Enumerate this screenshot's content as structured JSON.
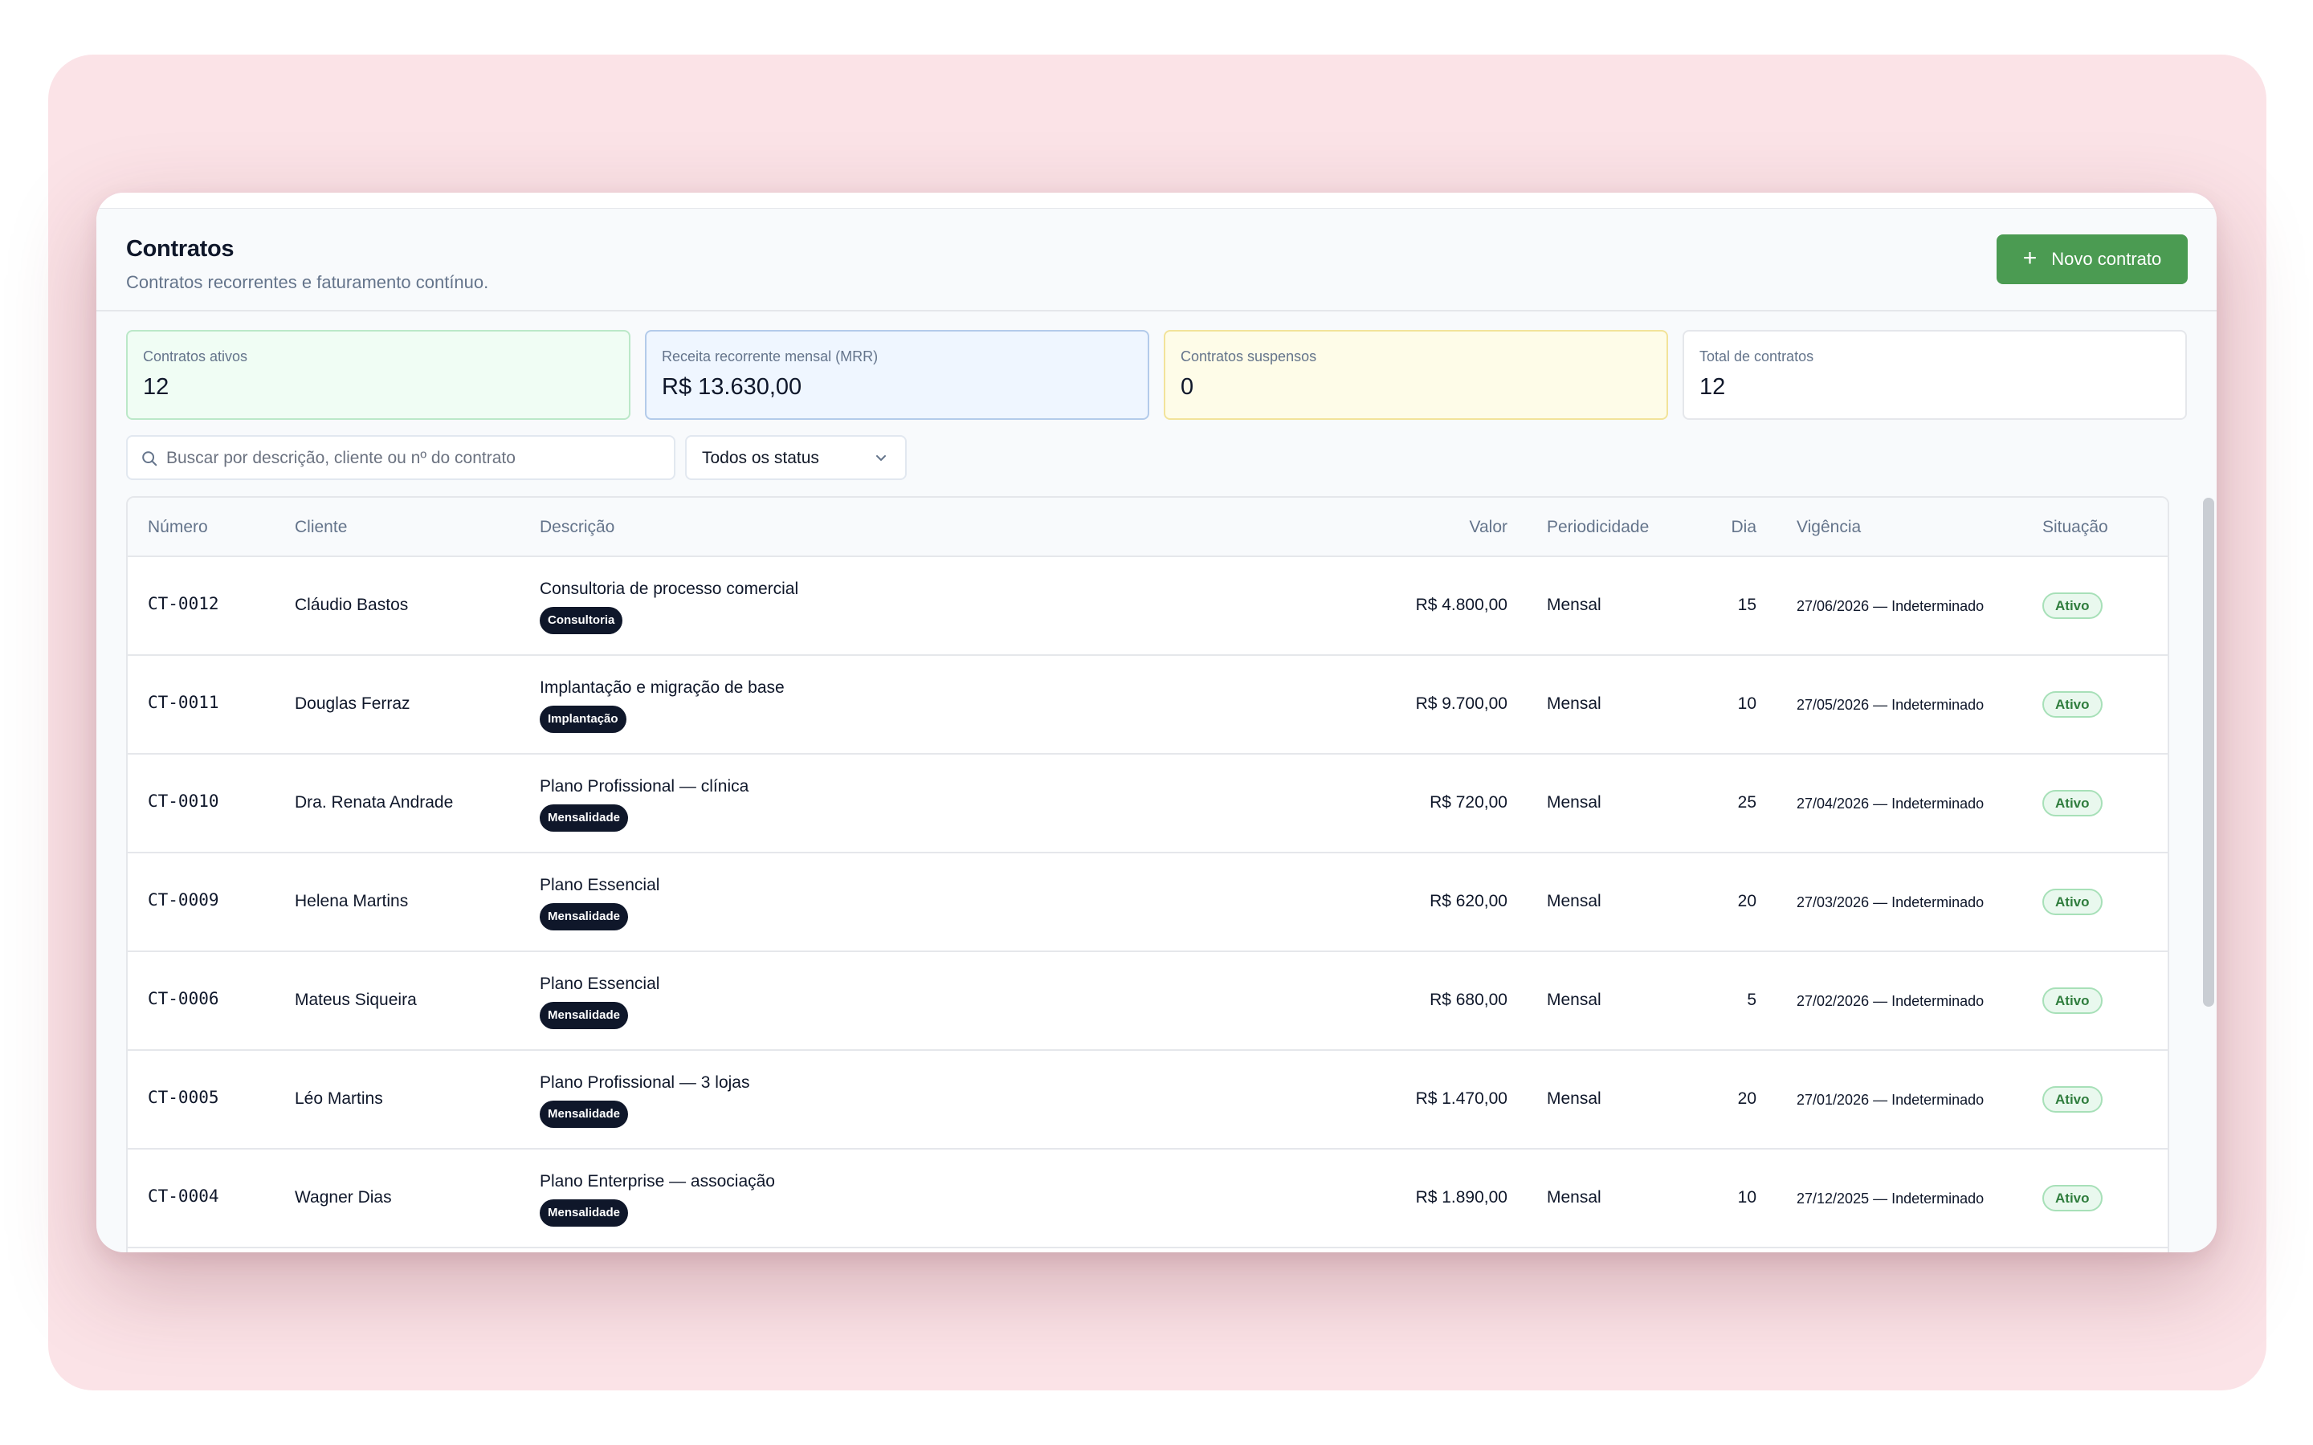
{
  "header": {
    "title": "Contratos",
    "subtitle": "Contratos recorrentes e faturamento contínuo.",
    "new_button_label": "Novo contrato"
  },
  "stats": [
    {
      "label": "Contratos ativos",
      "value": "12"
    },
    {
      "label": "Receita recorrente mensal (MRR)",
      "value": "R$ 13.630,00"
    },
    {
      "label": "Contratos suspensos",
      "value": "0"
    },
    {
      "label": "Total de contratos",
      "value": "12"
    }
  ],
  "filters": {
    "search_placeholder": "Buscar por descrição, cliente ou nº do contrato",
    "status_selected": "Todos os status"
  },
  "table": {
    "columns": [
      "Número",
      "Cliente",
      "Descrição",
      "Valor",
      "Periodicidade",
      "Dia",
      "Vigência",
      "Situação"
    ],
    "rows": [
      {
        "numero": "CT-0012",
        "cliente": "Cláudio Bastos",
        "descricao": "Consultoria de processo comercial",
        "tag": "Consultoria",
        "valor": "R$ 4.800,00",
        "periodicidade": "Mensal",
        "dia": "15",
        "vigencia": "27/06/2026 — Indeterminado",
        "situacao": "Ativo"
      },
      {
        "numero": "CT-0011",
        "cliente": "Douglas Ferraz",
        "descricao": "Implantação e migração de base",
        "tag": "Implantação",
        "valor": "R$ 9.700,00",
        "periodicidade": "Mensal",
        "dia": "10",
        "vigencia": "27/05/2026 — Indeterminado",
        "situacao": "Ativo"
      },
      {
        "numero": "CT-0010",
        "cliente": "Dra. Renata Andrade",
        "descricao": "Plano Profissional — clínica",
        "tag": "Mensalidade",
        "valor": "R$ 720,00",
        "periodicidade": "Mensal",
        "dia": "25",
        "vigencia": "27/04/2026 — Indeterminado",
        "situacao": "Ativo"
      },
      {
        "numero": "CT-0009",
        "cliente": "Helena Martins",
        "descricao": "Plano Essencial",
        "tag": "Mensalidade",
        "valor": "R$ 620,00",
        "periodicidade": "Mensal",
        "dia": "20",
        "vigencia": "27/03/2026 — Indeterminado",
        "situacao": "Ativo"
      },
      {
        "numero": "CT-0006",
        "cliente": "Mateus Siqueira",
        "descricao": "Plano Essencial",
        "tag": "Mensalidade",
        "valor": "R$ 680,00",
        "periodicidade": "Mensal",
        "dia": "5",
        "vigencia": "27/02/2026 — Indeterminado",
        "situacao": "Ativo"
      },
      {
        "numero": "CT-0005",
        "cliente": "Léo Martins",
        "descricao": "Plano Profissional — 3 lojas",
        "tag": "Mensalidade",
        "valor": "R$ 1.470,00",
        "periodicidade": "Mensal",
        "dia": "20",
        "vigencia": "27/01/2026 — Indeterminado",
        "situacao": "Ativo"
      },
      {
        "numero": "CT-0004",
        "cliente": "Wagner Dias",
        "descricao": "Plano Enterprise — associação",
        "tag": "Mensalidade",
        "valor": "R$ 1.890,00",
        "periodicidade": "Mensal",
        "dia": "10",
        "vigencia": "27/12/2025 — Indeterminado",
        "situacao": "Ativo"
      }
    ]
  },
  "icons": {
    "new_button": "plus-icon",
    "search": "search-icon",
    "select": "chevron-down-icon"
  },
  "colors": {
    "primary_button": "#4b9b52",
    "active_badge_bg": "#e9f8ee",
    "active_badge_text": "#2f7d3d",
    "tag_bg": "#0f172a"
  }
}
